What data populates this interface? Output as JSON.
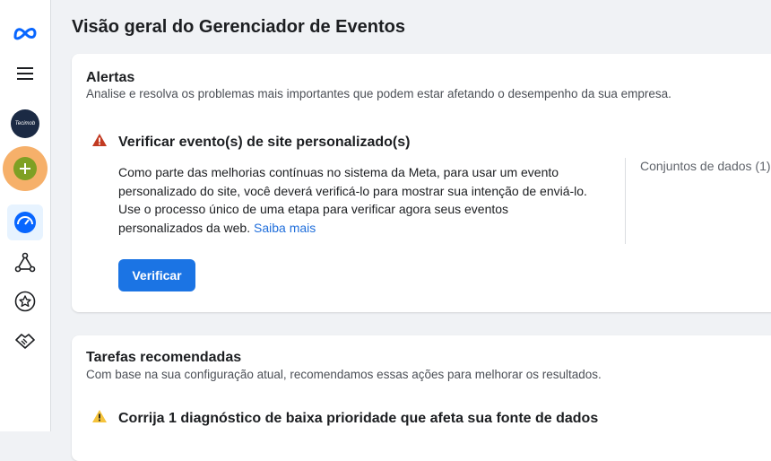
{
  "colors": {
    "accent": "#1b74e4",
    "error": "#c23b22",
    "warning": "#f5c33b"
  },
  "sidebar": {
    "icons": [
      "meta-logo-icon",
      "menu-icon",
      "account-avatar",
      "add-icon",
      "overview-icon",
      "connections-icon",
      "star-icon",
      "partner-icon"
    ],
    "avatar_text": "Tecimob"
  },
  "page": {
    "title": "Visão geral do Gerenciador de Eventos"
  },
  "alerts": {
    "title": "Alertas",
    "subtitle": "Analise e resolva os problemas mais importantes que podem estar afetando o desempenho da sua empresa.",
    "item": {
      "title": "Verificar evento(s) de site personalizado(s)",
      "body": "Como parte das melhorias contínuas no sistema da Meta, para usar um evento personalizado do site, você deverá verificá-lo para mostrar sua intenção de enviá-lo. Use o processo único de uma etapa para verificar agora seus eventos personalizados da web.",
      "link": "Saiba mais",
      "dataset_label": "Conjuntos de dados (1)",
      "button": "Verificar"
    }
  },
  "tasks": {
    "title": "Tarefas recomendadas",
    "subtitle": "Com base na sua configuração atual, recomendamos essas ações para melhorar os resultados.",
    "item": {
      "title": "Corrija 1 diagnóstico de baixa prioridade que afeta sua fonte de dados"
    }
  }
}
